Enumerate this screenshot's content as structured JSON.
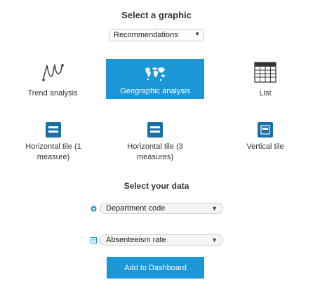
{
  "header": {
    "title": "Select a graphic"
  },
  "recommendations": {
    "selected": "Recommendations",
    "caret": "▼"
  },
  "graphics": {
    "trend": {
      "label": "Trend analysis",
      "icon": "trend-line-icon"
    },
    "geo": {
      "label": "Geographic analysis",
      "icon": "map-icon"
    },
    "list": {
      "label": "List",
      "icon": "table-grid-icon"
    },
    "horizontal1": {
      "label_line1": "Horizontal tile (1",
      "label_line2": "measure)",
      "icon": "horizontal-tile-icon"
    },
    "horizontal3": {
      "label_line1": "Horizontal tile (3",
      "label_line2": "measures)",
      "icon": "horizontal-tile-icon"
    },
    "vertical": {
      "label": "Vertical tile",
      "icon": "vertical-tile-icon"
    }
  },
  "data_section": {
    "title": "Select your data",
    "dimension": {
      "value": "Department code",
      "caret": "▼",
      "icon": "dimension-icon"
    },
    "measure": {
      "value": "Absenteeism rate",
      "caret": "▼",
      "icon": "measure-icon"
    }
  },
  "actions": {
    "add_label": "Add to Dashboard"
  },
  "colors": {
    "accent": "#1b96d6",
    "tile_dark": "#1a6fa3",
    "white": "#ffffff"
  }
}
